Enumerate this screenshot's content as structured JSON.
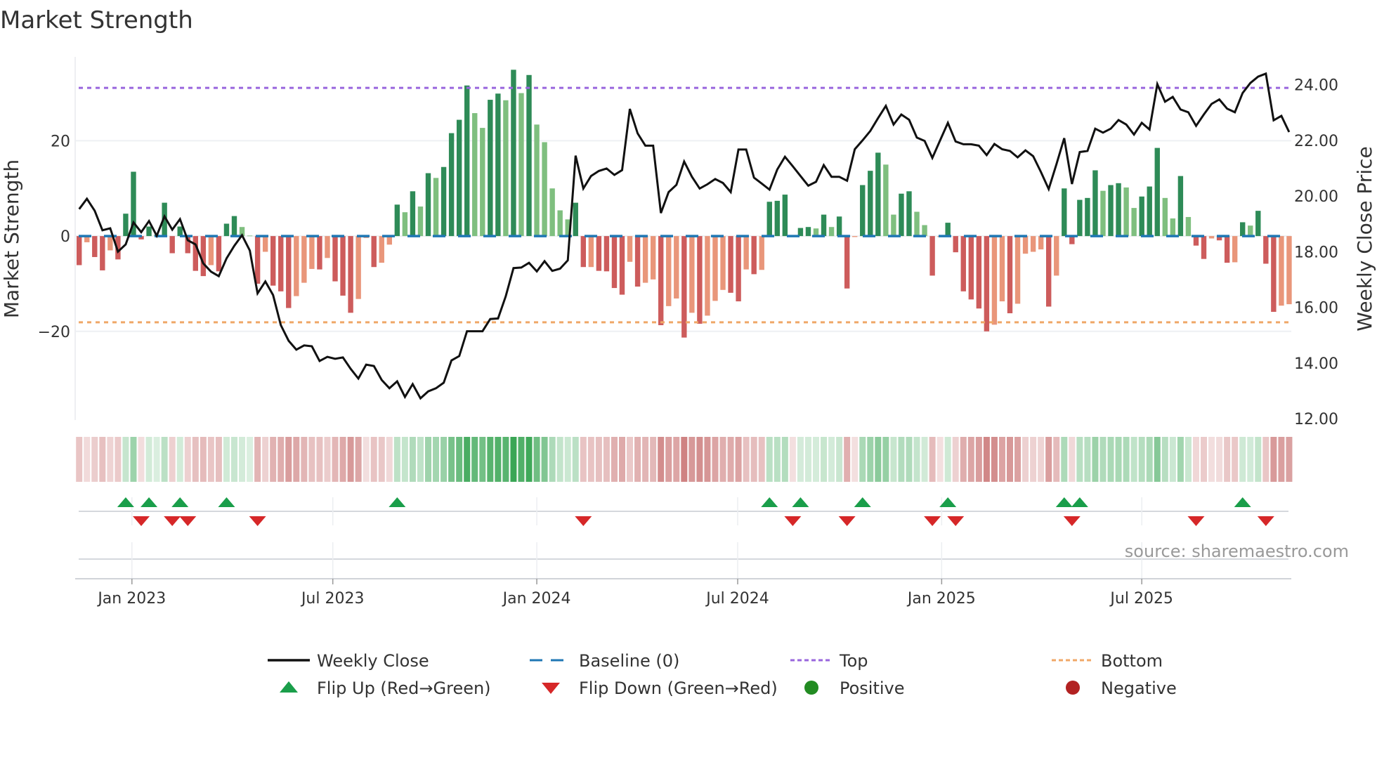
{
  "chart_data": {
    "type": "bar",
    "title": "Market Strength",
    "ylabel": "Market Strength",
    "ylabel_right": "Weekly Close Price",
    "source": "source: sharemaestro.com",
    "ylim_left": [
      -38.6,
      37.6
    ],
    "ylim_right": [
      11.95,
      25.0
    ],
    "top_level": 31.1,
    "bottom_level": -18.1,
    "y_left_ticks": [
      {
        "value": 20,
        "label": "20"
      },
      {
        "value": 0,
        "label": "0"
      },
      {
        "value": -20,
        "label": "−20"
      }
    ],
    "y_right_ticks": [
      {
        "value": 12,
        "label": "12.00"
      },
      {
        "value": 14,
        "label": "14.00"
      },
      {
        "value": 16,
        "label": "16.00"
      },
      {
        "value": 18,
        "label": "18.00"
      },
      {
        "value": 20,
        "label": "20.00"
      },
      {
        "value": 22,
        "label": "22.00"
      },
      {
        "value": 24,
        "label": "24.00"
      }
    ],
    "x_ticks": [
      {
        "label": "Jan 2023",
        "week": 6.8
      },
      {
        "label": "Jul 2023",
        "week": 32.7
      },
      {
        "label": "Jan 2024",
        "week": 59.0
      },
      {
        "label": "Jul 2024",
        "week": 84.9
      },
      {
        "label": "Jan 2025",
        "week": 111.2
      },
      {
        "label": "Jul 2025",
        "week": 137.0
      }
    ],
    "grid": true,
    "strength": [
      -6.1,
      -1.3,
      -4.4,
      -7.2,
      -3.0,
      -4.9,
      4.7,
      13.5,
      -0.7,
      2.0,
      0.3,
      7.0,
      -3.6,
      2.0,
      -3.6,
      -7.3,
      -8.4,
      -6.1,
      -7.4,
      2.6,
      4.2,
      1.9,
      0.1,
      -10.0,
      -3.3,
      -10.4,
      -11.6,
      -15.1,
      -12.6,
      -9.8,
      -6.9,
      -7.0,
      -4.6,
      -9.5,
      -12.5,
      -16.1,
      -13.2,
      -0.4,
      -6.5,
      -5.6,
      -1.8,
      6.6,
      5.0,
      9.4,
      6.2,
      13.2,
      12.2,
      14.5,
      21.6,
      24.4,
      31.6,
      25.8,
      22.7,
      28.6,
      29.9,
      28.5,
      34.9,
      30.0,
      33.8,
      23.4,
      19.7,
      10.0,
      5.4,
      3.5,
      7.0,
      -6.5,
      -6.5,
      -7.3,
      -7.4,
      -10.9,
      -12.3,
      -5.4,
      -10.6,
      -9.8,
      -9.1,
      -18.7,
      -14.7,
      -13.1,
      -21.3,
      -16.1,
      -18.4,
      -16.7,
      -13.6,
      -11.3,
      -11.9,
      -13.7,
      -7.0,
      -8.0,
      -7.1,
      7.2,
      7.4,
      8.7,
      -0.2,
      1.7,
      1.9,
      1.6,
      4.5,
      1.9,
      4.1,
      -11.0,
      -0.2,
      10.7,
      13.7,
      17.5,
      15.0,
      4.5,
      8.9,
      9.4,
      5.1,
      2.3,
      -8.3,
      -0.2,
      2.8,
      -3.4,
      -11.6,
      -13.3,
      -15.2,
      -20.0,
      -18.6,
      -13.7,
      -16.2,
      -14.2,
      -3.7,
      -3.3,
      -2.8,
      -14.8,
      -8.3,
      10.0,
      -1.7,
      7.6,
      8.0,
      13.8,
      9.5,
      10.7,
      11.1,
      10.2,
      5.9,
      8.3,
      10.4,
      18.5,
      8.0,
      3.7,
      12.6,
      4.0,
      -2.0,
      -4.8,
      -0.5,
      -0.9,
      -5.6,
      -5.5,
      2.9,
      2.2,
      5.3,
      -5.8,
      -15.9,
      -14.6,
      -14.3
    ],
    "weekly_close": [
      19.53,
      19.9,
      19.47,
      18.77,
      18.84,
      18.0,
      18.26,
      19.05,
      18.7,
      19.1,
      18.57,
      19.27,
      18.79,
      19.17,
      18.41,
      18.26,
      17.58,
      17.28,
      17.12,
      17.76,
      18.21,
      18.59,
      18.04,
      16.5,
      16.93,
      16.44,
      15.36,
      14.8,
      14.48,
      14.63,
      14.6,
      14.07,
      14.22,
      14.15,
      14.2,
      13.79,
      13.44,
      13.94,
      13.89,
      13.39,
      13.09,
      13.34,
      12.78,
      13.24,
      12.73,
      12.98,
      13.09,
      13.29,
      14.09,
      14.25,
      15.14,
      15.14,
      15.14,
      15.58,
      15.6,
      16.4,
      17.41,
      17.43,
      17.6,
      17.29,
      17.66,
      17.31,
      17.39,
      17.69,
      21.45,
      20.27,
      20.72,
      20.9,
      20.99,
      20.76,
      20.93,
      23.13,
      22.25,
      21.81,
      21.81,
      19.39,
      20.14,
      20.4,
      21.24,
      20.69,
      20.27,
      20.42,
      20.61,
      20.47,
      20.14,
      21.67,
      21.67,
      20.66,
      20.45,
      20.23,
      20.95,
      21.41,
      21.07,
      20.72,
      20.37,
      20.51,
      21.11,
      20.69,
      20.69,
      20.55,
      21.68,
      22.0,
      22.34,
      22.8,
      23.24,
      22.57,
      22.93,
      22.74,
      22.1,
      21.98,
      21.37,
      22.0,
      22.63,
      21.96,
      21.86,
      21.86,
      21.81,
      21.47,
      21.87,
      21.68,
      21.62,
      21.39,
      21.64,
      21.43,
      20.86,
      20.25,
      21.14,
      22.08,
      20.43,
      21.58,
      21.62,
      22.42,
      22.28,
      22.42,
      22.73,
      22.57,
      22.21,
      22.63,
      22.39,
      24.02,
      23.39,
      23.56,
      23.11,
      23.01,
      22.52,
      22.93,
      23.31,
      23.47,
      23.14,
      23.01,
      23.7,
      24.06,
      24.29,
      24.4,
      22.72,
      22.88,
      22.3
    ],
    "flip_up_weeks": [
      6,
      9,
      13,
      19,
      41,
      89,
      93,
      101,
      112,
      127,
      129,
      150
    ],
    "flip_down_weeks": [
      8,
      12,
      14,
      23,
      65,
      92,
      99,
      110,
      113,
      128,
      144,
      153
    ],
    "legend": [
      {
        "key": "close",
        "label": "Weekly Close"
      },
      {
        "key": "baseline",
        "label": "Baseline (0)"
      },
      {
        "key": "top",
        "label": "Top"
      },
      {
        "key": "bottom",
        "label": "Bottom"
      },
      {
        "key": "flip_up",
        "label": "Flip Up (Red→Green)"
      },
      {
        "key": "flip_down",
        "label": "Flip Down (Green→Red)"
      },
      {
        "key": "positive",
        "label": "Positive"
      },
      {
        "key": "negative",
        "label": "Negative"
      }
    ],
    "legend_placement": "bottom",
    "colors": {
      "pos_strong": "#2e8b57",
      "pos_weak": "#7fbf7f",
      "neg_strong": "#cd5c5c",
      "neg_weak": "#e9967a",
      "close": "#111111",
      "baseline": "#1f77b4",
      "top": "#9966dd",
      "bottom": "#f0a868",
      "flip_up": "#1a9e4a",
      "flip_down": "#d62728",
      "positive": "#228b22",
      "negative": "#b22222"
    }
  }
}
